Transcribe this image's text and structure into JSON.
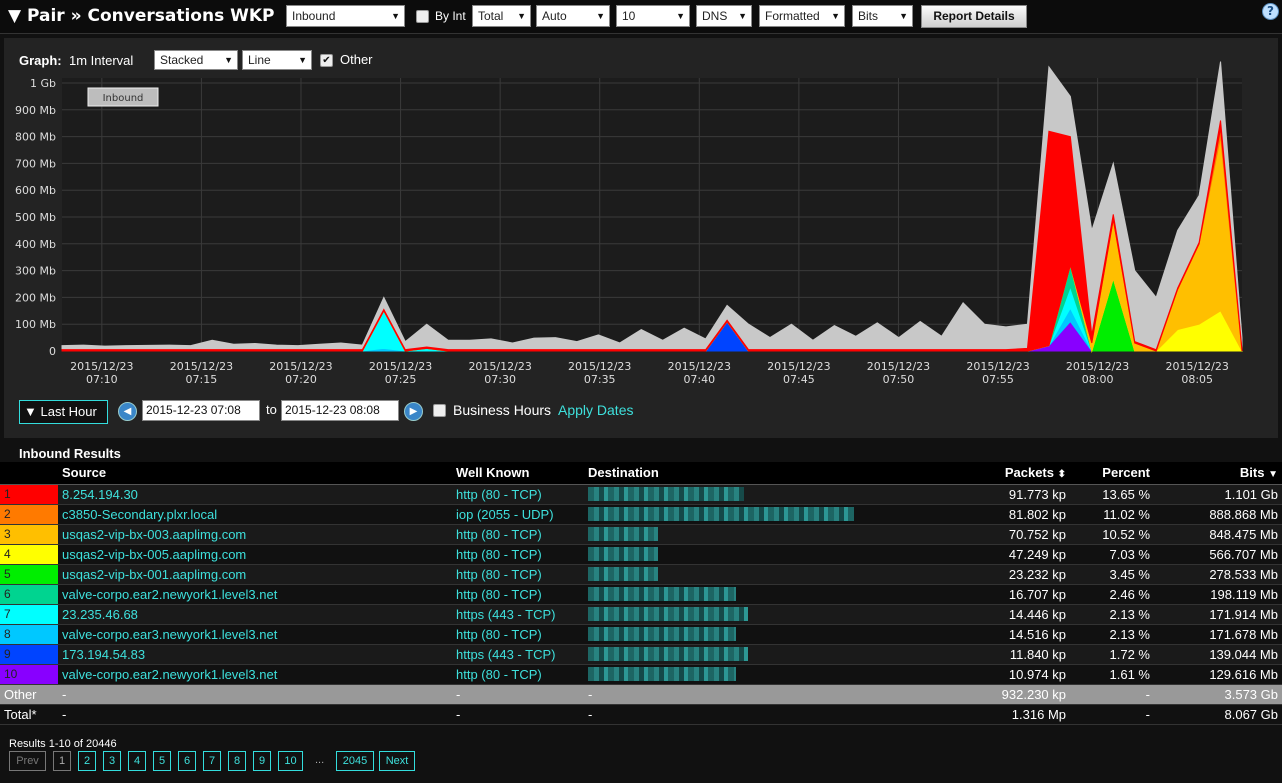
{
  "header": {
    "title": "▼ Pair » Conversations WKP",
    "direction_select": "Inbound",
    "by_int_label": "By Int",
    "total_select": "Total",
    "auto_select": "Auto",
    "count_select": "10",
    "dns_select": "DNS",
    "formatted_select": "Formatted",
    "bits_select": "Bits",
    "report_button": "Report Details",
    "help": "?"
  },
  "graph_controls": {
    "graph_label": "Graph:",
    "interval_label": "1m Interval",
    "stack_select": "Stacked",
    "line_select": "Line",
    "other_label": "Other"
  },
  "chart_data": {
    "type": "area",
    "legend": [
      "Inbound"
    ],
    "y_ticks": [
      "0",
      "100 Mb",
      "200 Mb",
      "300 Mb",
      "400 Mb",
      "500 Mb",
      "600 Mb",
      "700 Mb",
      "800 Mb",
      "900 Mb",
      "1 Gb"
    ],
    "ylim": [
      0,
      1000
    ],
    "yunit": "Mb",
    "x_ticks": [
      [
        "2015/12/23",
        "07:10"
      ],
      [
        "2015/12/23",
        "07:15"
      ],
      [
        "2015/12/23",
        "07:20"
      ],
      [
        "2015/12/23",
        "07:25"
      ],
      [
        "2015/12/23",
        "07:30"
      ],
      [
        "2015/12/23",
        "07:35"
      ],
      [
        "2015/12/23",
        "07:40"
      ],
      [
        "2015/12/23",
        "07:45"
      ],
      [
        "2015/12/23",
        "07:50"
      ],
      [
        "2015/12/23",
        "07:55"
      ],
      [
        "2015/12/23",
        "08:00"
      ],
      [
        "2015/12/23",
        "08:05"
      ]
    ],
    "x_start": "07:08",
    "x_end": "08:08",
    "grid": true,
    "series_colors": [
      "#ff0000",
      "#ff7a00",
      "#ffbf00",
      "#ffff00",
      "#00ee00",
      "#00d490",
      "#00ffff",
      "#00c8ff",
      "#0044ff",
      "#8800ff"
    ],
    "other_color": "#c8c8c8",
    "total_values": [
      20,
      22,
      18,
      20,
      21,
      22,
      20,
      40,
      25,
      28,
      22,
      20,
      25,
      30,
      22,
      200,
      35,
      100,
      40,
      40,
      45,
      30,
      48,
      50,
      35,
      60,
      30,
      80,
      40,
      85,
      45,
      170,
      100,
      50,
      100,
      40,
      95,
      55,
      105,
      50,
      110,
      55,
      180,
      100,
      90,
      100,
      1060,
      950,
      450,
      700,
      300,
      200,
      450,
      580,
      1080,
      50
    ],
    "stack_values": {
      "series_1": [
        5,
        5,
        5,
        5,
        5,
        5,
        5,
        5,
        5,
        5,
        5,
        5,
        5,
        5,
        5,
        5,
        5,
        5,
        5,
        5,
        5,
        5,
        5,
        5,
        5,
        5,
        5,
        5,
        5,
        5,
        5,
        5,
        5,
        5,
        5,
        5,
        5,
        5,
        5,
        5,
        5,
        5,
        5,
        5,
        5,
        10,
        800,
        480,
        30,
        20,
        5,
        5,
        5,
        5,
        30,
        5
      ],
      "series_2": [
        0,
        0,
        0,
        0,
        0,
        0,
        0,
        0,
        0,
        0,
        0,
        0,
        0,
        0,
        0,
        0,
        0,
        0,
        0,
        0,
        0,
        0,
        0,
        0,
        0,
        0,
        0,
        0,
        0,
        0,
        0,
        0,
        0,
        0,
        0,
        0,
        0,
        0,
        0,
        0,
        0,
        0,
        0,
        0,
        0,
        0,
        0,
        0,
        0,
        0,
        0,
        0,
        0,
        0,
        30,
        0
      ],
      "series_3": [
        0,
        0,
        0,
        0,
        0,
        0,
        0,
        0,
        0,
        0,
        0,
        0,
        0,
        0,
        0,
        0,
        0,
        0,
        0,
        0,
        0,
        0,
        0,
        0,
        0,
        0,
        0,
        0,
        0,
        0,
        0,
        0,
        0,
        0,
        0,
        0,
        0,
        0,
        0,
        0,
        0,
        0,
        0,
        0,
        0,
        0,
        0,
        0,
        30,
        220,
        30,
        0,
        150,
        300,
        650,
        0
      ],
      "series_4": [
        0,
        0,
        0,
        0,
        0,
        0,
        0,
        0,
        0,
        0,
        0,
        0,
        0,
        0,
        0,
        0,
        0,
        0,
        0,
        0,
        0,
        0,
        0,
        0,
        0,
        0,
        0,
        0,
        0,
        0,
        0,
        0,
        0,
        0,
        0,
        0,
        0,
        0,
        0,
        0,
        0,
        0,
        0,
        0,
        0,
        0,
        0,
        0,
        0,
        0,
        0,
        0,
        80,
        100,
        150,
        0
      ],
      "series_5": [
        0,
        0,
        0,
        0,
        0,
        0,
        0,
        0,
        0,
        0,
        0,
        0,
        0,
        0,
        0,
        0,
        0,
        0,
        0,
        0,
        0,
        0,
        0,
        0,
        0,
        0,
        0,
        0,
        0,
        0,
        0,
        0,
        0,
        0,
        0,
        0,
        0,
        0,
        0,
        0,
        0,
        0,
        0,
        0,
        0,
        0,
        0,
        0,
        0,
        270,
        0,
        0,
        0,
        0,
        0,
        0
      ],
      "series_6": [
        0,
        0,
        0,
        0,
        0,
        0,
        0,
        0,
        0,
        0,
        0,
        0,
        0,
        0,
        0,
        0,
        0,
        0,
        0,
        0,
        0,
        0,
        0,
        0,
        0,
        0,
        0,
        0,
        0,
        0,
        0,
        0,
        0,
        0,
        0,
        0,
        0,
        0,
        0,
        0,
        0,
        0,
        0,
        0,
        0,
        0,
        0,
        80,
        0,
        0,
        0,
        0,
        0,
        0,
        0,
        0
      ],
      "series_7": [
        0,
        0,
        0,
        0,
        0,
        0,
        0,
        0,
        0,
        0,
        0,
        0,
        0,
        0,
        0,
        140,
        0,
        10,
        0,
        0,
        0,
        0,
        0,
        0,
        0,
        0,
        0,
        0,
        0,
        0,
        0,
        0,
        0,
        0,
        0,
        0,
        0,
        0,
        0,
        0,
        0,
        0,
        0,
        0,
        0,
        0,
        0,
        80,
        0,
        0,
        0,
        0,
        0,
        0,
        0,
        0
      ],
      "series_8": [
        0,
        0,
        0,
        0,
        0,
        0,
        0,
        0,
        0,
        0,
        0,
        0,
        0,
        0,
        0,
        10,
        0,
        0,
        0,
        0,
        0,
        0,
        0,
        0,
        0,
        0,
        0,
        0,
        0,
        0,
        0,
        0,
        0,
        0,
        0,
        0,
        0,
        0,
        0,
        0,
        0,
        0,
        0,
        0,
        0,
        0,
        0,
        50,
        0,
        0,
        0,
        0,
        0,
        0,
        0,
        0
      ],
      "series_9": [
        0,
        0,
        0,
        0,
        0,
        0,
        0,
        0,
        0,
        0,
        0,
        0,
        0,
        0,
        0,
        0,
        0,
        0,
        0,
        0,
        0,
        0,
        0,
        0,
        0,
        0,
        0,
        0,
        0,
        0,
        0,
        110,
        0,
        0,
        0,
        0,
        0,
        0,
        0,
        0,
        0,
        0,
        0,
        0,
        0,
        0,
        0,
        0,
        0,
        0,
        0,
        0,
        0,
        0,
        0,
        0
      ],
      "series_10": [
        0,
        0,
        0,
        0,
        0,
        0,
        0,
        0,
        0,
        0,
        0,
        0,
        0,
        0,
        0,
        0,
        0,
        0,
        0,
        0,
        0,
        0,
        0,
        0,
        0,
        0,
        0,
        0,
        0,
        0,
        0,
        0,
        0,
        0,
        0,
        0,
        0,
        0,
        0,
        0,
        0,
        0,
        0,
        0,
        0,
        0,
        20,
        110,
        0,
        0,
        0,
        0,
        0,
        0,
        0,
        0
      ]
    }
  },
  "date_controls": {
    "range_button": "▼ Last Hour",
    "start": "2015-12-23 07:08",
    "to_label": "to",
    "end": "2015-12-23 08:08",
    "business_hours_label": "Business Hours",
    "apply_label": "Apply Dates"
  },
  "results": {
    "title": "Inbound Results",
    "columns": [
      "Source",
      "Well Known",
      "Destination",
      "Packets",
      "Percent",
      "Bits"
    ],
    "rows": [
      {
        "idx": "1",
        "color": "#ff0000",
        "source": "8.254.194.30",
        "well_known": "http (80 - TCP)",
        "packets": "91.773 kp",
        "percent": "13.65 %",
        "bits": "1.101 Gb"
      },
      {
        "idx": "2",
        "color": "#ff7a00",
        "source": "c3850-Secondary.plxr.local",
        "well_known": "iop (2055 - UDP)",
        "packets": "81.802 kp",
        "percent": "11.02 %",
        "bits": "888.868 Mb"
      },
      {
        "idx": "3",
        "color": "#ffbf00",
        "source": "usqas2-vip-bx-003.aaplimg.com",
        "well_known": "http (80 - TCP)",
        "packets": "70.752 kp",
        "percent": "10.52 %",
        "bits": "848.475 Mb"
      },
      {
        "idx": "4",
        "color": "#ffff00",
        "source": "usqas2-vip-bx-005.aaplimg.com",
        "well_known": "http (80 - TCP)",
        "packets": "47.249 kp",
        "percent": "7.03 %",
        "bits": "566.707 Mb"
      },
      {
        "idx": "5",
        "color": "#00ee00",
        "source": "usqas2-vip-bx-001.aaplimg.com",
        "well_known": "http (80 - TCP)",
        "packets": "23.232 kp",
        "percent": "3.45 %",
        "bits": "278.533 Mb"
      },
      {
        "idx": "6",
        "color": "#00d490",
        "source": "valve-corpo.ear2.newyork1.level3.net",
        "well_known": "http (80 - TCP)",
        "packets": "16.707 kp",
        "percent": "2.46 %",
        "bits": "198.119 Mb"
      },
      {
        "idx": "7",
        "color": "#00ffff",
        "source": "23.235.46.68",
        "well_known": "https (443 - TCP)",
        "packets": "14.446 kp",
        "percent": "2.13 %",
        "bits": "171.914 Mb"
      },
      {
        "idx": "8",
        "color": "#00c8ff",
        "source": "valve-corpo.ear3.newyork1.level3.net",
        "well_known": "http (80 - TCP)",
        "packets": "14.516 kp",
        "percent": "2.13 %",
        "bits": "171.678 Mb"
      },
      {
        "idx": "9",
        "color": "#0044ff",
        "source": "173.194.54.83",
        "well_known": "https (443 - TCP)",
        "packets": "11.840 kp",
        "percent": "1.72 %",
        "bits": "139.044 Mb"
      },
      {
        "idx": "10",
        "color": "#8800ff",
        "source": "valve-corpo.ear2.newyork1.level3.net",
        "well_known": "http (80 - TCP)",
        "packets": "10.974 kp",
        "percent": "1.61 %",
        "bits": "129.616 Mb"
      }
    ],
    "other": {
      "label": "Other",
      "source": "-",
      "well_known": "-",
      "destination": "-",
      "packets": "932.230 kp",
      "percent": "-",
      "bits": "3.573 Gb"
    },
    "total": {
      "label": "Total*",
      "source": "-",
      "well_known": "-",
      "destination": "-",
      "packets": "1.316 Mp",
      "percent": "-",
      "bits": "8.067 Gb"
    }
  },
  "pagination": {
    "summary": "Results 1-10 of 20446",
    "prev": "Prev",
    "pages": [
      "1",
      "2",
      "3",
      "4",
      "5",
      "6",
      "7",
      "8",
      "9",
      "10"
    ],
    "ellipsis": "...",
    "last": "2045",
    "next": "Next"
  }
}
